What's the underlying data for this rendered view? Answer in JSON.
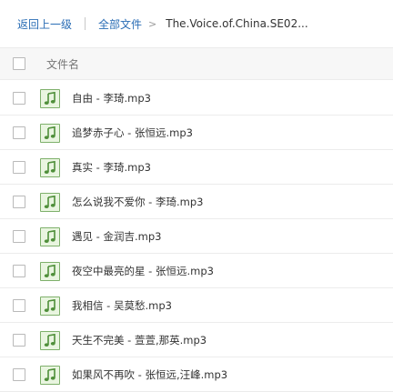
{
  "breadcrumb": {
    "back_label": "返回上一级",
    "all_files_label": "全部文件",
    "arrow": ">",
    "current_folder": "The.Voice.of.China.SE02..."
  },
  "header": {
    "filename_column": "文件名"
  },
  "files": [
    {
      "name": "自由 - 李琦.mp3",
      "icon": "music-file-icon"
    },
    {
      "name": "追梦赤子心 - 张恒远.mp3",
      "icon": "music-file-icon"
    },
    {
      "name": "真实 - 李琦.mp3",
      "icon": "music-file-icon"
    },
    {
      "name": "怎么说我不爱你 - 李琦.mp3",
      "icon": "music-file-icon"
    },
    {
      "name": "遇见 - 金润吉.mp3",
      "icon": "music-file-icon"
    },
    {
      "name": "夜空中最亮的星 - 张恒远.mp3",
      "icon": "music-file-icon"
    },
    {
      "name": "我相信 - 吴莫愁.mp3",
      "icon": "music-file-icon"
    },
    {
      "name": "天生不完美 - 萱萱,那英.mp3",
      "icon": "music-file-icon"
    },
    {
      "name": "如果风不再吹 - 张恒远,汪峰.mp3",
      "icon": "music-file-icon"
    }
  ],
  "colors": {
    "link": "#2a6db5",
    "icon_border": "#7eb06b",
    "icon_fill": "#e9f5e0",
    "icon_note": "#4f8f3a"
  }
}
